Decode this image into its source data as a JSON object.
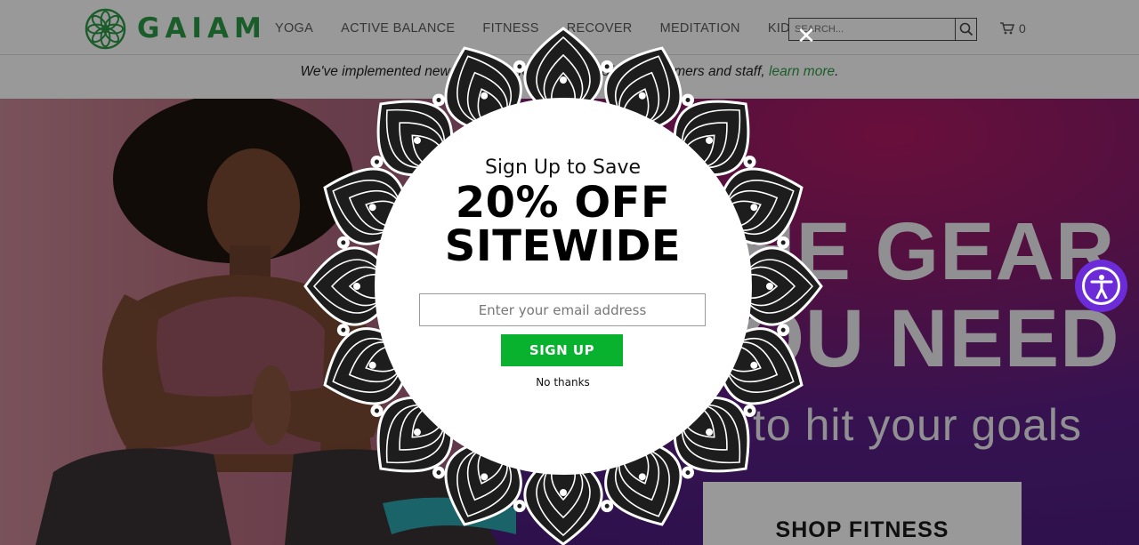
{
  "header": {
    "logo_text": "GAIAM",
    "logo_icon": "flower-of-life-icon",
    "nav": [
      "YOGA",
      "ACTIVE BALANCE",
      "FITNESS",
      "RECOVER",
      "MEDITATION",
      "KIDS"
    ],
    "search": {
      "placeholder": "SEARCH...",
      "icon": "search-icon"
    },
    "cart": {
      "icon": "cart-icon",
      "count": "0"
    }
  },
  "announcement": {
    "text": "We've implemented new measures for the safety of our customers and staff,",
    "link": "learn more",
    "end": "."
  },
  "hero": {
    "headline_1": "THE GEAR",
    "headline_2": "YOU NEED",
    "subline": "to hit your goals",
    "cta": "SHOP FITNESS"
  },
  "popup": {
    "kicker": "Sign Up to Save",
    "headline_1": "20% OFF",
    "headline_2": "SITEWIDE",
    "email_placeholder": "Enter your email address",
    "submit_label": "SIGN UP",
    "decline_label": "No thanks",
    "close_icon": "close-icon",
    "accent_color": "#08b12e"
  },
  "accessibility": {
    "icon": "accessibility-icon",
    "color": "#6b2bd8"
  },
  "colors": {
    "brand_green": "#2e9b46"
  }
}
